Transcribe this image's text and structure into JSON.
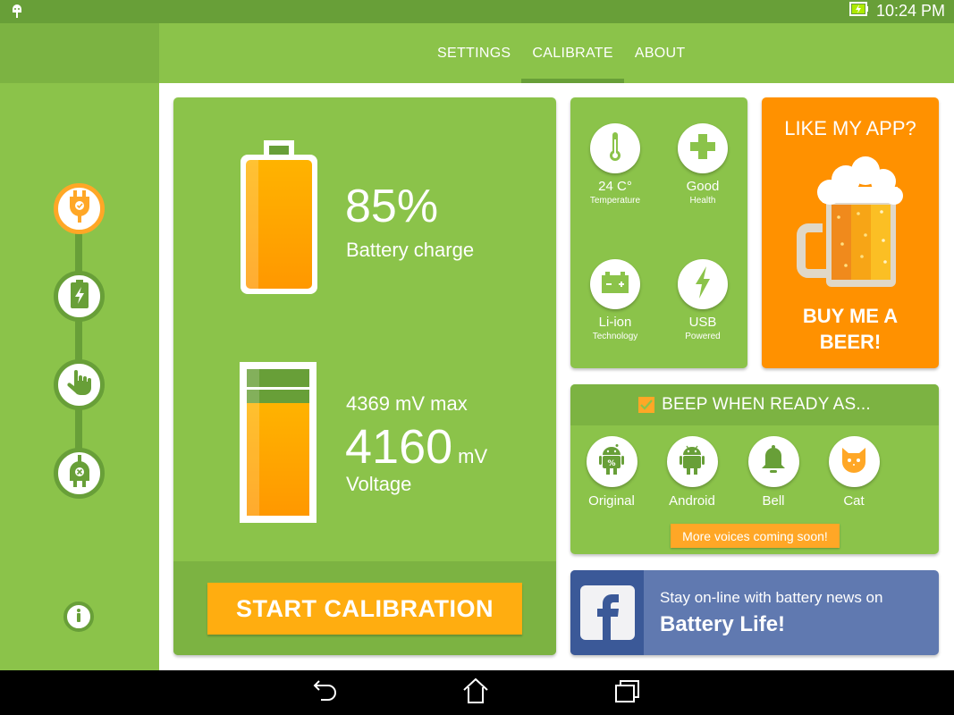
{
  "status_bar": {
    "time": "10:24 PM",
    "icons": [
      "android-debug-icon",
      "battery-charging-icon"
    ]
  },
  "tabs": [
    {
      "label": "SETTINGS",
      "active": false
    },
    {
      "label": "CALIBRATE",
      "active": true
    },
    {
      "label": "ABOUT",
      "active": false
    }
  ],
  "sidebar": {
    "steps": [
      {
        "name": "plug-in",
        "icon": "plug-check-icon",
        "active": true
      },
      {
        "name": "charge",
        "icon": "battery-charge-icon",
        "active": false
      },
      {
        "name": "tap",
        "icon": "hand-pointer-icon",
        "active": false
      },
      {
        "name": "unplug",
        "icon": "plug-x-icon",
        "active": false
      }
    ],
    "info_icon": "info-icon"
  },
  "battery": {
    "charge_percent": 85,
    "charge_value": "85%",
    "charge_label": "Battery charge",
    "voltage_max": "4369 mV max",
    "voltage_value": "4160",
    "voltage_unit": "mV",
    "voltage_label": "Voltage",
    "voltage_fraction": 0.82,
    "start_button": "START CALIBRATION"
  },
  "stats": [
    {
      "value": "24 C°",
      "label": "Temperature",
      "icon": "thermometer-icon"
    },
    {
      "value": "Good",
      "label": "Health",
      "icon": "health-cross-icon"
    },
    {
      "value": "Li-ion",
      "label": "Technology",
      "icon": "car-battery-icon"
    },
    {
      "value": "USB",
      "label": "Powered",
      "icon": "lightning-icon"
    }
  ],
  "beer": {
    "title": "LIKE MY APP?",
    "cta_line1": "BUY ME A",
    "cta_line2": "BEER!"
  },
  "beep": {
    "checked": true,
    "title": "BEEP WHEN READY AS...",
    "voices": [
      {
        "label": "Original",
        "icon": "android-percent-icon"
      },
      {
        "label": "Android",
        "icon": "android-icon"
      },
      {
        "label": "Bell",
        "icon": "bell-icon"
      },
      {
        "label": "Cat",
        "icon": "cat-icon"
      }
    ],
    "more": "More voices coming soon!"
  },
  "facebook": {
    "line1": "Stay on-line with battery news on",
    "line2": "Battery Life!"
  },
  "colors": {
    "primary": "#8bc34a",
    "primary_dark": "#689f38",
    "accent": "#ffa726",
    "beer_orange": "#ff9100",
    "facebook": "#3b5998"
  }
}
